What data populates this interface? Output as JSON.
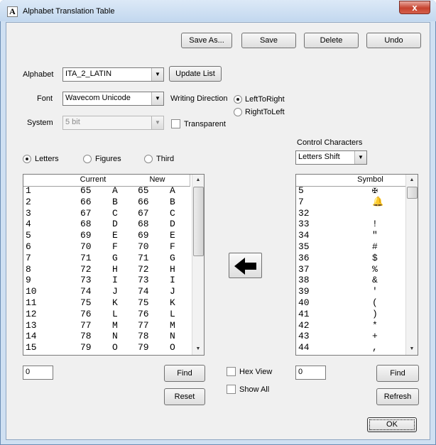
{
  "window": {
    "title": "Alphabet Translation Table",
    "app_icon": "A",
    "close_label": "x"
  },
  "toolbar": {
    "save_as": "Save As...",
    "save": "Save",
    "delete": "Delete",
    "undo": "Undo"
  },
  "alphabet": {
    "label": "Alphabet",
    "value": "ITA_2_LATIN",
    "update_list": "Update List"
  },
  "font": {
    "label": "Font",
    "value": "Wavecom Unicode"
  },
  "system": {
    "label": "System",
    "value": "5 bit"
  },
  "writing_direction": {
    "label": "Writing Direction",
    "options": [
      "LeftToRight",
      "RightToLeft"
    ],
    "selected": "LeftToRight"
  },
  "transparent_label": "Transparent",
  "mode": {
    "options": [
      "Letters",
      "Figures",
      "Third"
    ],
    "selected": "Letters"
  },
  "control_characters": {
    "label": "Control Characters",
    "value": "Letters Shift"
  },
  "left_table": {
    "headers": [
      "",
      "Current",
      "",
      "New",
      ""
    ],
    "rows": [
      [
        "1",
        "65",
        "A",
        "65",
        "A"
      ],
      [
        "2",
        "66",
        "B",
        "66",
        "B"
      ],
      [
        "3",
        "67",
        "C",
        "67",
        "C"
      ],
      [
        "4",
        "68",
        "D",
        "68",
        "D"
      ],
      [
        "5",
        "69",
        "E",
        "69",
        "E"
      ],
      [
        "6",
        "70",
        "F",
        "70",
        "F"
      ],
      [
        "7",
        "71",
        "G",
        "71",
        "G"
      ],
      [
        "8",
        "72",
        "H",
        "72",
        "H"
      ],
      [
        "9",
        "73",
        "I",
        "73",
        "I"
      ],
      [
        "10",
        "74",
        "J",
        "74",
        "J"
      ],
      [
        "11",
        "75",
        "K",
        "75",
        "K"
      ],
      [
        "12",
        "76",
        "L",
        "76",
        "L"
      ],
      [
        "13",
        "77",
        "M",
        "77",
        "M"
      ],
      [
        "14",
        "78",
        "N",
        "78",
        "N"
      ],
      [
        "15",
        "79",
        "O",
        "79",
        "O"
      ]
    ]
  },
  "right_table": {
    "headers": [
      "",
      "Symbol"
    ],
    "rows": [
      [
        "5",
        "✠"
      ],
      [
        "7",
        "🔔"
      ],
      [
        "32",
        ""
      ],
      [
        "33",
        "!"
      ],
      [
        "34",
        "\""
      ],
      [
        "35",
        "#"
      ],
      [
        "36",
        "$"
      ],
      [
        "37",
        "%"
      ],
      [
        "38",
        "&"
      ],
      [
        "39",
        "'"
      ],
      [
        "40",
        "("
      ],
      [
        "41",
        ")"
      ],
      [
        "42",
        "*"
      ],
      [
        "43",
        "+"
      ],
      [
        "44",
        ","
      ]
    ]
  },
  "left_find": {
    "value": "0",
    "button": "Find"
  },
  "reset": "Reset",
  "hex_view": "Hex View",
  "show_all": "Show All",
  "right_find": {
    "value": "0",
    "button": "Find"
  },
  "refresh": "Refresh",
  "ok": "OK",
  "icons": {
    "transfer": "arrow-left-icon"
  }
}
